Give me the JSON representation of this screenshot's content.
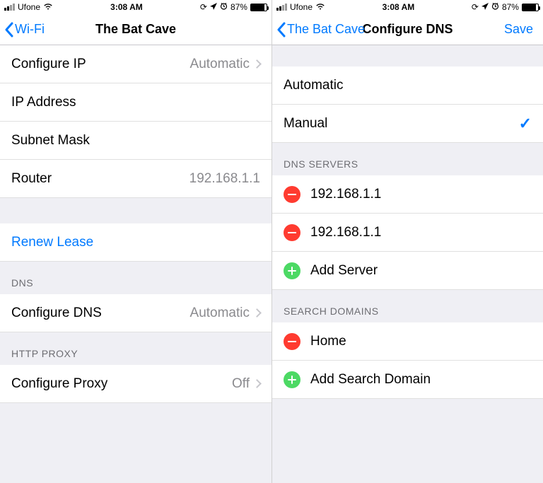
{
  "status": {
    "carrier": "Ufone",
    "time": "3:08 AM",
    "battery_pct": "87%"
  },
  "left": {
    "back_label": "Wi-Fi",
    "title": "The Bat Cave",
    "rows": {
      "configure_ip_label": "Configure IP",
      "configure_ip_value": "Automatic",
      "ip_address_label": "IP Address",
      "subnet_label": "Subnet Mask",
      "router_label": "Router",
      "router_value": "192.168.1.1",
      "renew_lease": "Renew Lease",
      "dns_header": "DNS",
      "configure_dns_label": "Configure DNS",
      "configure_dns_value": "Automatic",
      "proxy_header": "HTTP PROXY",
      "configure_proxy_label": "Configure Proxy",
      "configure_proxy_value": "Off"
    }
  },
  "right": {
    "back_label": "The Bat Cave",
    "title": "Configure DNS",
    "save_label": "Save",
    "options": {
      "automatic": "Automatic",
      "manual": "Manual"
    },
    "dns_header": "DNS SERVERS",
    "servers": [
      "192.168.1.1",
      "192.168.1.1"
    ],
    "add_server": "Add Server",
    "search_header": "SEARCH DOMAINS",
    "domains": [
      "Home"
    ],
    "add_domain": "Add Search Domain"
  }
}
